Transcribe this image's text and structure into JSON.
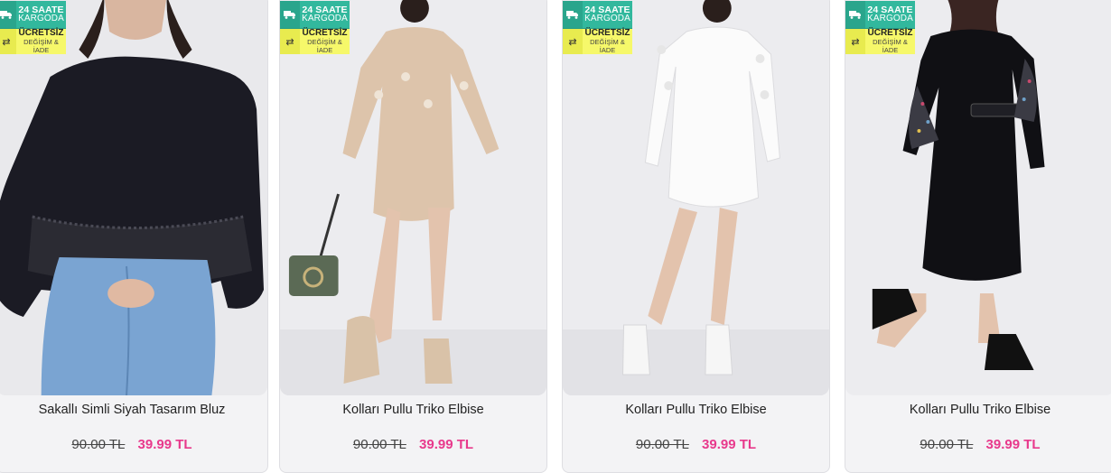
{
  "colors": {
    "ship_badge": "#32b89d",
    "free_badge": "#f6f86a",
    "sale_price": "#e8398c",
    "card_background": "#f3f3f5"
  },
  "products": [
    {
      "title": "Sakallı Simli Siyah Tasarım Bluz",
      "old_price": "90.00 TL",
      "new_price": "39.99 TL",
      "badge_ship_line1": "24 SAATE",
      "badge_ship_line2": "KARGODA",
      "badge_free_line1": "ÜCRETSİZ",
      "badge_free_line2": "DEĞİŞİM & İADE",
      "ship_icon": "truck-icon",
      "return_icon": "exchange-icon"
    },
    {
      "title": "Kolları Pullu Triko Elbise",
      "old_price": "90.00 TL",
      "new_price": "39.99 TL",
      "badge_ship_line1": "24 SAATE",
      "badge_ship_line2": "KARGODA",
      "badge_free_line1": "ÜCRETSİZ",
      "badge_free_line2": "DEĞİŞİM & İADE",
      "ship_icon": "truck-icon",
      "return_icon": "exchange-icon"
    },
    {
      "title": "Kolları Pullu Triko Elbise",
      "old_price": "90.00 TL",
      "new_price": "39.99 TL",
      "badge_ship_line1": "24 SAATE",
      "badge_ship_line2": "KARGODA",
      "badge_free_line1": "ÜCRETSİZ",
      "badge_free_line2": "DEĞİŞİM & İADE",
      "ship_icon": "truck-icon",
      "return_icon": "exchange-icon"
    },
    {
      "title": "Kolları Pullu Triko Elbise",
      "old_price": "90.00 TL",
      "new_price": "39.99 TL",
      "badge_ship_line1": "24 SAATE",
      "badge_ship_line2": "KARGODA",
      "badge_free_line1": "ÜCRETSİZ",
      "badge_free_line2": "DEĞİŞİM & İADE",
      "ship_icon": "truck-icon",
      "return_icon": "exchange-icon"
    }
  ]
}
